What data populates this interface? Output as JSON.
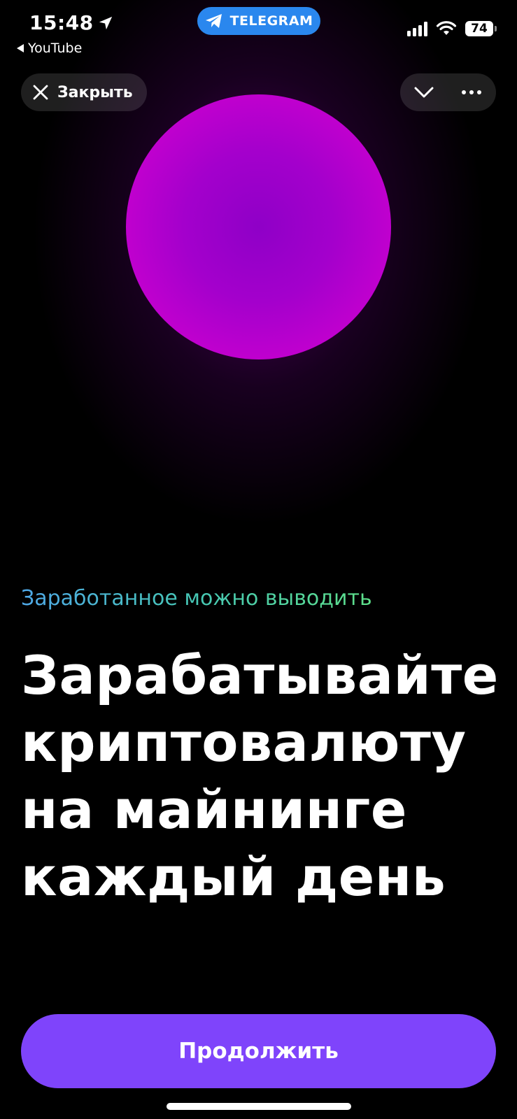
{
  "status_bar": {
    "time": "15:48",
    "back_app": "YouTube",
    "telegram_label": "TELEGRAM",
    "battery": "74"
  },
  "header": {
    "close_label": "Закрыть"
  },
  "content": {
    "subtitle": "Заработанное можно выводить",
    "headline_lines": [
      "Зарабатывайте",
      "криптовалюту",
      "на майнинге",
      "каждый день"
    ]
  },
  "cta": {
    "label": "Продолжить"
  },
  "colors": {
    "background": "#000000",
    "orb": "#c800cf",
    "cta": "#7f44fb",
    "telegram_pill": "#2a87ee"
  }
}
